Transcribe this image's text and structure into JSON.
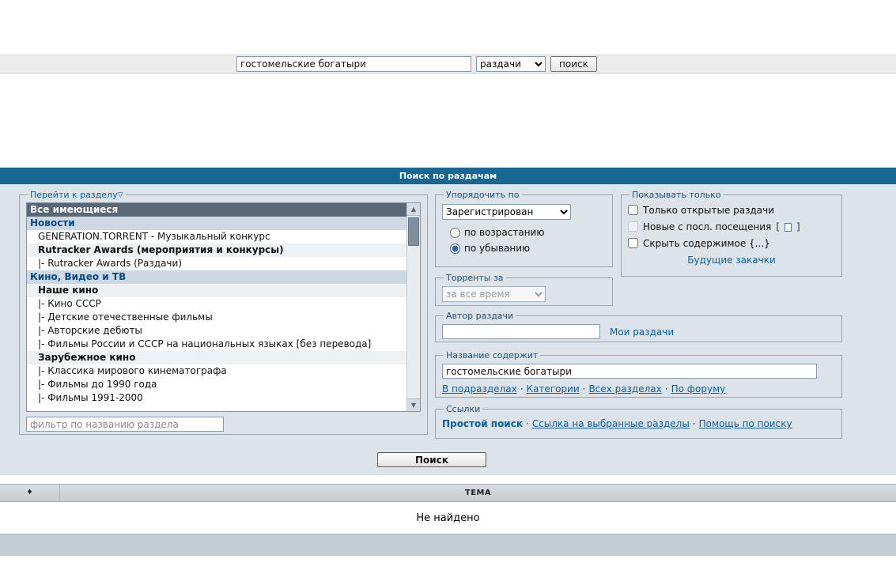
{
  "top_bar": {
    "search_value": "гостомельские богатыри",
    "scope_select": "раздачи",
    "search_button": "поиск"
  },
  "panel": {
    "title": "Поиск по раздачам",
    "sep": "·",
    "tree": {
      "legend": "Перейти к разделу",
      "filter_icon": "▽",
      "scroll_up_icon": "▲",
      "scroll_down_icon": "▼",
      "items": [
        {
          "label": "Все имеющиеся",
          "type": "selected"
        },
        {
          "label": "Новости",
          "type": "root"
        },
        {
          "label": "GENERATION.TORRENT - Музыкальный конкурс",
          "type": "item"
        },
        {
          "label": "Rutracker Awards (мероприятия и конкурсы)",
          "type": "bold"
        },
        {
          "label": "|- Rutracker Awards (Раздачи)",
          "type": "item"
        },
        {
          "label": "Кино, Видео и ТВ",
          "type": "root"
        },
        {
          "label": "Наше кино",
          "type": "bold"
        },
        {
          "label": "|- Кино СССР",
          "type": "item"
        },
        {
          "label": "|- Детские отечественные фильмы",
          "type": "item"
        },
        {
          "label": "|- Авторские дебюты",
          "type": "item"
        },
        {
          "label": "|- Фильмы России и СССР на национальных языках [без перевода]",
          "type": "item"
        },
        {
          "label": "Зарубежное кино",
          "type": "bold"
        },
        {
          "label": "|- Классика мирового кинематографа",
          "type": "item"
        },
        {
          "label": "|- Фильмы до 1990 года",
          "type": "item"
        },
        {
          "label": "|- Фильмы 1991-2000",
          "type": "item"
        }
      ],
      "filter_placeholder": "фильтр по названию раздела"
    },
    "order": {
      "legend": "Упорядочить по",
      "select_value": "Зарегистрирован",
      "radio_asc": "по возрастанию",
      "radio_desc": "по убыванию"
    },
    "time": {
      "legend": "Торренты за",
      "select_value": "за все время"
    },
    "show_only": {
      "legend": "Показывать только",
      "cb_open": "Только открытые раздачи",
      "cb_new": "Новые с посл. посещения",
      "cb_new_bracket_open": "[",
      "cb_new_bracket_close": "]",
      "cb_hide": "Скрыть содержимое {...}",
      "link_future": "Будущие закачки"
    },
    "author": {
      "legend": "Автор раздачи",
      "link_my": "Мои раздачи"
    },
    "title_contains": {
      "legend": "Название содержит",
      "value": "гостомельские богатыри",
      "links": [
        "В подразделах",
        "Категории",
        "Всех разделах",
        "По форуму"
      ]
    },
    "links_section": {
      "legend": "Ссылки",
      "links": [
        "Простой поиск",
        "Ссылка на выбранные разделы",
        "Помощь по поиску"
      ]
    },
    "submit": "Поиск"
  },
  "results": {
    "sort_icon": "♦",
    "header": "ТЕМА",
    "empty": "Не найдено"
  },
  "colors": {
    "title_bar": "#166892",
    "panel_bg": "#dce3e9",
    "link": "#0861a8",
    "selected_row_bg": "#5a6876",
    "root_row_bg": "#cdd8e2",
    "footer_bg": "#c3ced6"
  }
}
